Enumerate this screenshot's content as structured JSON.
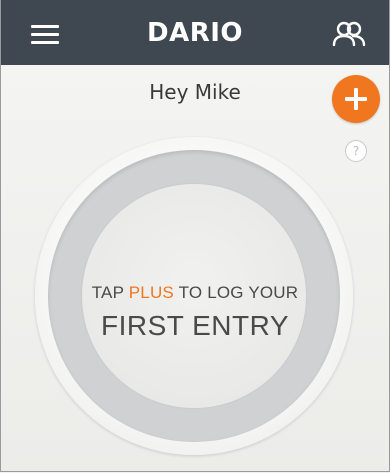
{
  "header": {
    "title": "DARIO",
    "menu_icon": "hamburger-menu-icon",
    "profile_icon": "users-icon",
    "background_color": "#3f4750"
  },
  "greeting": "Hey Mike",
  "actions": {
    "add_icon": "plus-icon",
    "add_color": "#f0761f",
    "help_label": "?"
  },
  "empty_state": {
    "line1_prefix": "TAP",
    "line1_accent": "PLUS",
    "line1_suffix": "TO LOG YOUR",
    "line2": "FIRST ENTRY",
    "accent_color": "#f0761f"
  }
}
